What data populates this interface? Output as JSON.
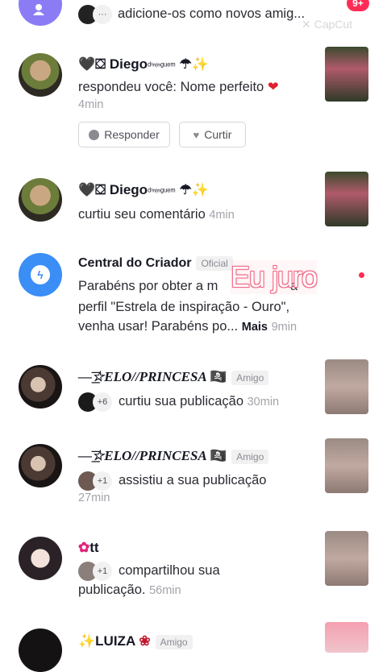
{
  "top": {
    "text": "adicione-os como novos amig...",
    "badge": "9+",
    "watermark": "CapCut"
  },
  "items": [
    {
      "name": "Diego",
      "name_suffix": "ᵈⁱⁿᵎⁿᵍᵘᵉᵐ",
      "text": "respondeu você: Nome perfeito",
      "time": "4min",
      "reply_label": "Responder",
      "like_label": "Curtir"
    },
    {
      "name": "Diego",
      "name_suffix": "ᵈⁱⁿᵎⁿᵍᵘᵉᵐ",
      "text": "curtiu seu comentário",
      "time": "4min"
    },
    {
      "name": "Central do Criador",
      "tag": "Oficial",
      "line1": "Parabéns por obter a m",
      "line1_end": "a",
      "line2": "perfil \"Estrela de inspiração - Ouro\",",
      "line3": "venha usar! Parabéns po...",
      "more": "Mais",
      "time": "9min",
      "overlay": "Eu juro"
    },
    {
      "name": "—͟͞☆ELO//PRINCESA",
      "tag": "Amigo",
      "count": "+6",
      "text": "curtiu sua publicação",
      "time": "30min"
    },
    {
      "name": "—͟͞☆ELO//PRINCESA",
      "tag": "Amigo",
      "count": "+1",
      "text": "assistiu a sua publicação",
      "time": "27min"
    },
    {
      "name": "tt",
      "count": "+1",
      "text": "compartilhou sua",
      "text2": "publicação.",
      "time": "56min"
    },
    {
      "name": "LUIZA",
      "tag": "Amigo"
    }
  ]
}
